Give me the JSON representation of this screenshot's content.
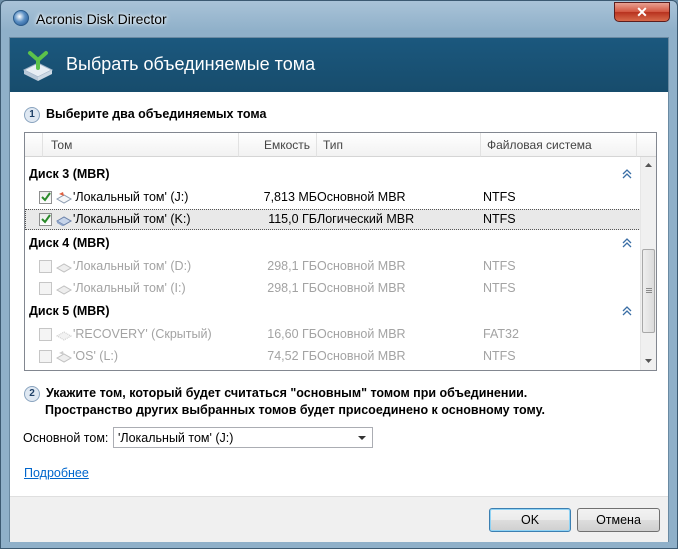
{
  "window": {
    "title": "Acronis Disk Director",
    "close_label": "✕"
  },
  "header": {
    "title": "Выбрать объединяемые тома"
  },
  "step1": {
    "number": "1",
    "text": "Выберите два объединяемых тома"
  },
  "table": {
    "columns": [
      "Том",
      "Емкость",
      "Тип",
      "Файловая система"
    ],
    "groups": [
      {
        "name": "Диск 3 (MBR)",
        "rows": [
          {
            "name": "'Локальный том' (J:)",
            "capacity": "7,813 МБ",
            "type": "Основной MBR",
            "fs": "NTFS",
            "checked": true,
            "enabled": true,
            "selected": false
          },
          {
            "name": "'Локальный том' (K:)",
            "capacity": "115,0 ГБ",
            "type": "Логический MBR",
            "fs": "NTFS",
            "checked": true,
            "enabled": true,
            "selected": true
          }
        ]
      },
      {
        "name": "Диск 4 (MBR)",
        "rows": [
          {
            "name": "'Локальный том' (D:)",
            "capacity": "298,1 ГБ",
            "type": "Основной MBR",
            "fs": "NTFS",
            "checked": false,
            "enabled": false,
            "selected": false
          },
          {
            "name": "'Локальный том' (I:)",
            "capacity": "298,1 ГБ",
            "type": "Основной MBR",
            "fs": "NTFS",
            "checked": false,
            "enabled": false,
            "selected": false
          }
        ]
      },
      {
        "name": "Диск 5 (MBR)",
        "rows": [
          {
            "name": "'RECOVERY' (Скрытый)",
            "capacity": "16,60 ГБ",
            "type": "Основной MBR",
            "fs": "FAT32",
            "checked": false,
            "enabled": false,
            "selected": false
          },
          {
            "name": "'OS' (L:)",
            "capacity": "74,52 ГБ",
            "type": "Основной MBR",
            "fs": "NTFS",
            "checked": false,
            "enabled": false,
            "selected": false
          }
        ]
      }
    ]
  },
  "step2": {
    "number": "2",
    "line1": "Укажите том, который будет считаться \"основным\" томом при объединении.",
    "line2": "Пространство других выбранных томов будет присоединено к основному тому."
  },
  "main_volume": {
    "label": "Основной том:",
    "value": "'Локальный том' (J:)"
  },
  "details_link": "Подробнее",
  "buttons": {
    "ok": "OK",
    "cancel": "Отмена"
  },
  "colors": {
    "header_band": "#1b587e",
    "link": "#0066cc",
    "accent_check": "#2a8a2a"
  }
}
